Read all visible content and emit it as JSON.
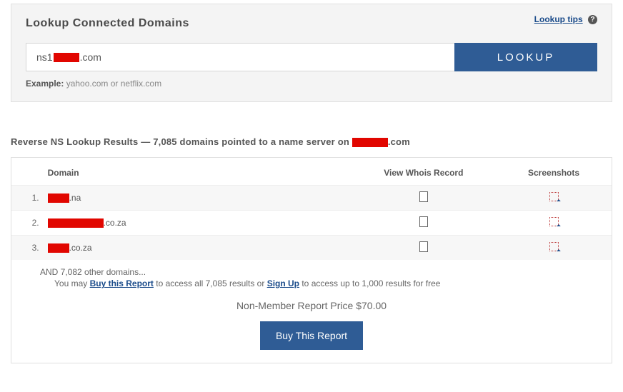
{
  "lookup_panel": {
    "title": "Lookup Connected Domains",
    "tips_label": "Lookup tips",
    "input_value_prefix": "ns1",
    "input_value_suffix": ".com",
    "button_label": "LOOKUP",
    "example_label": "Example:",
    "example_text": "yahoo.com or netflix.com"
  },
  "results_heading": {
    "prefix": "Reverse NS Lookup Results — 7,085 domains pointed to a name server on ",
    "suffix": ".com"
  },
  "table": {
    "col_domain": "Domain",
    "col_whois": "View Whois Record",
    "col_ss": "Screenshots",
    "rows": [
      {
        "num": "1.",
        "suffix": ".na",
        "redact_w": 30
      },
      {
        "num": "2.",
        "suffix": ".co.za",
        "redact_w": 78
      },
      {
        "num": "3.",
        "suffix": ".co.za",
        "redact_w": 30
      }
    ]
  },
  "footer": {
    "and_line": "AND 7,082 other domains...",
    "buy_pre": "You may ",
    "buy_link": "Buy this Report",
    "buy_mid": " to access all 7,085 results or ",
    "signup_link": "Sign Up",
    "buy_post": " to access up to 1,000 results for free",
    "price_line": "Non-Member Report Price $70.00",
    "buy_button": "Buy This Report"
  }
}
